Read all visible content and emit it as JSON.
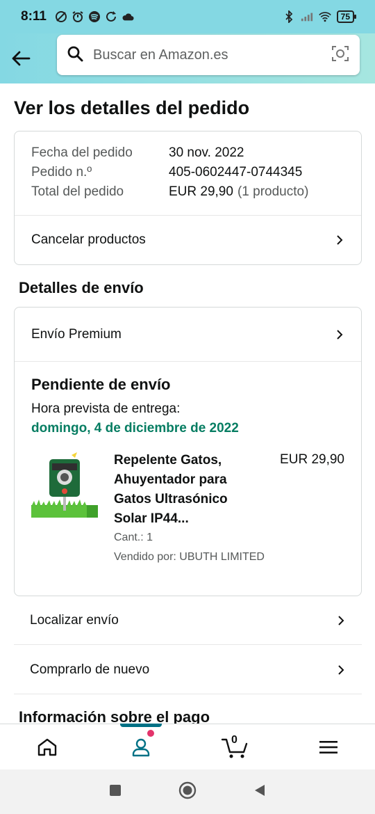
{
  "status_bar": {
    "time": "8:11",
    "battery": "75"
  },
  "header": {
    "search_placeholder": "Buscar en Amazon.es"
  },
  "page": {
    "title": "Ver los detalles del pedido"
  },
  "order": {
    "date_label": "Fecha del pedido",
    "date_value": "30 nov. 2022",
    "number_label": "Pedido n.º",
    "number_value": "405-0602447-0744345",
    "total_label": "Total del pedido",
    "total_value": "EUR 29,90",
    "total_count": "(1 producto)",
    "cancel_label": "Cancelar productos"
  },
  "shipping": {
    "section_title": "Detalles de envío",
    "method": "Envío Premium",
    "status": "Pendiente de envío",
    "eta_label": "Hora prevista de entrega:",
    "eta_date": "domingo, 4 de diciembre de 2022",
    "product": {
      "title": "Repelente Gatos, Ahuyentador para Gatos Ultrasónico Solar IP44...",
      "price": "EUR 29,90",
      "qty": "Cant.: 1",
      "seller": "Vendido por: UBUTH LIMITED"
    },
    "track_label": "Localizar envío",
    "buy_again_label": "Comprarlo de nuevo"
  },
  "payment": {
    "section_title": "Información sobre el pago"
  },
  "bottom_nav": {
    "cart_count": "0"
  },
  "colors": {
    "accent": "#007185",
    "delivery_green": "#067d62",
    "header_bg": "#84d8e3",
    "notification_dot": "#e3346b"
  }
}
